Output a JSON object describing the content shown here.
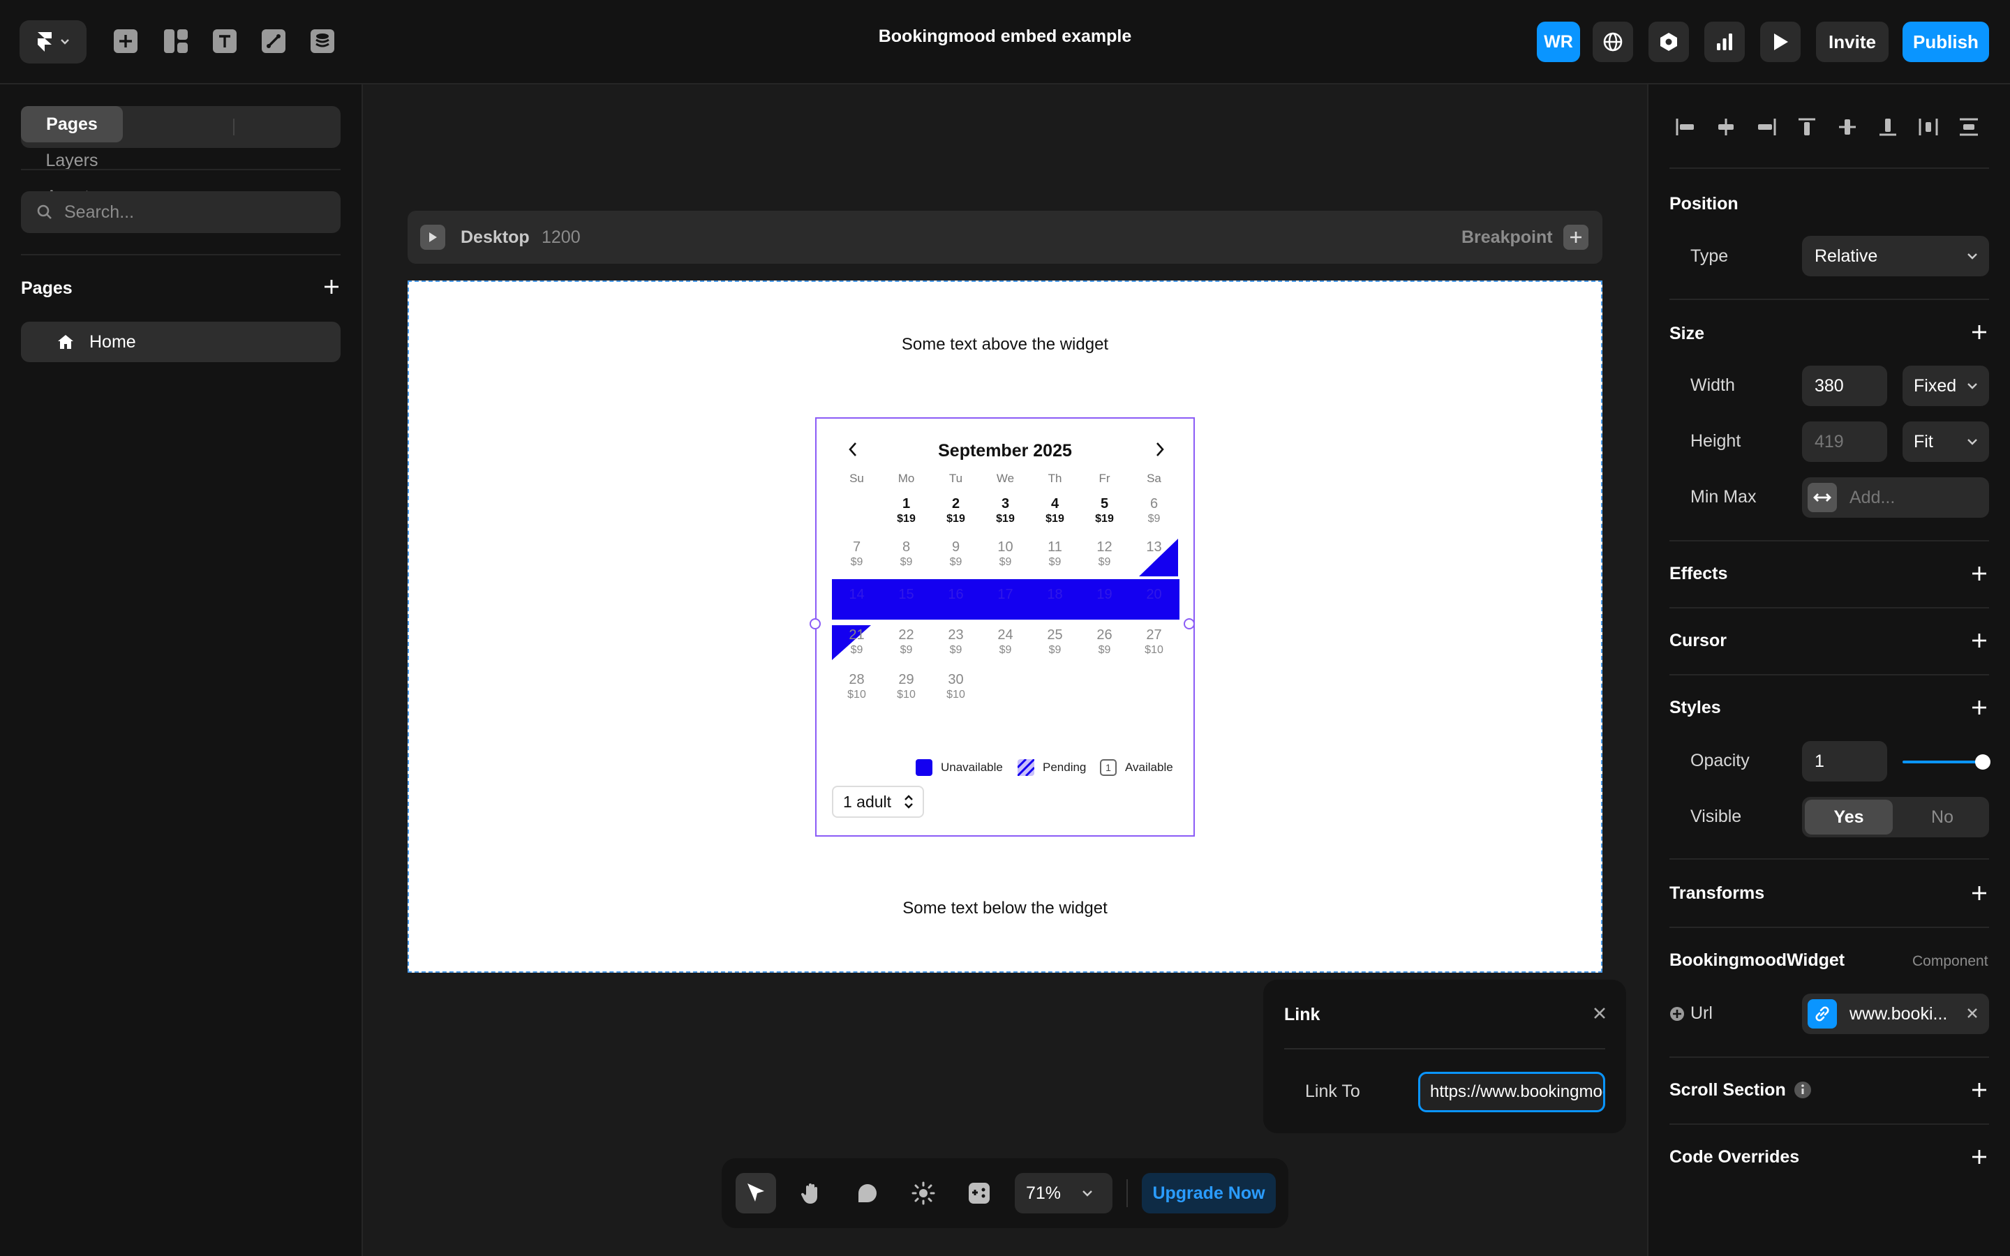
{
  "topbar": {
    "project_title": "Bookingmood embed example",
    "avatar_initials": "WR",
    "invite_label": "Invite",
    "publish_label": "Publish"
  },
  "left_panel": {
    "tabs": [
      "Pages",
      "Layers",
      "Assets"
    ],
    "active_tab": "Pages",
    "search_placeholder": "Search...",
    "pages_heading": "Pages",
    "pages": [
      {
        "label": "Home"
      }
    ]
  },
  "canvas": {
    "breakpoint": {
      "name": "Desktop",
      "width": "1200",
      "label": "Breakpoint"
    },
    "text_above": "Some text above the widget",
    "text_below": "Some text below the widget"
  },
  "widget": {
    "month_title": "September 2025",
    "weekdays": [
      "Su",
      "Mo",
      "Tu",
      "We",
      "Th",
      "Fr",
      "Sa"
    ],
    "legend": {
      "unavailable": "Unavailable",
      "pending": "Pending",
      "available": "Available",
      "available_icon_text": "1"
    },
    "guests": "1 adult",
    "colors": {
      "unavailable": "#1400f0",
      "pending": "#8c7cf0",
      "border": "#8b5cf6"
    },
    "rows": [
      [
        {
          "d": "",
          "p": "",
          "s": "empty"
        },
        {
          "d": "1",
          "p": "$19",
          "s": "available"
        },
        {
          "d": "2",
          "p": "$19",
          "s": "available"
        },
        {
          "d": "3",
          "p": "$19",
          "s": "available"
        },
        {
          "d": "4",
          "p": "$19",
          "s": "available"
        },
        {
          "d": "5",
          "p": "$19",
          "s": "available"
        },
        {
          "d": "6",
          "p": "$9",
          "s": "past"
        }
      ],
      [
        {
          "d": "7",
          "p": "$9",
          "s": "past"
        },
        {
          "d": "8",
          "p": "$9",
          "s": "past"
        },
        {
          "d": "9",
          "p": "$9",
          "s": "past"
        },
        {
          "d": "10",
          "p": "$9",
          "s": "past"
        },
        {
          "d": "11",
          "p": "$9",
          "s": "past"
        },
        {
          "d": "12",
          "p": "$9",
          "s": "past"
        },
        {
          "d": "13",
          "p": "",
          "s": "checkin"
        }
      ],
      [
        {
          "d": "14",
          "p": "",
          "s": "unavailable"
        },
        {
          "d": "15",
          "p": "",
          "s": "unavailable"
        },
        {
          "d": "16",
          "p": "",
          "s": "unavailable"
        },
        {
          "d": "17",
          "p": "",
          "s": "unavailable"
        },
        {
          "d": "18",
          "p": "",
          "s": "unavailable"
        },
        {
          "d": "19",
          "p": "",
          "s": "unavailable"
        },
        {
          "d": "20",
          "p": "",
          "s": "unavailable"
        }
      ],
      [
        {
          "d": "21",
          "p": "$9",
          "s": "checkout"
        },
        {
          "d": "22",
          "p": "$9",
          "s": "past"
        },
        {
          "d": "23",
          "p": "$9",
          "s": "past"
        },
        {
          "d": "24",
          "p": "$9",
          "s": "past"
        },
        {
          "d": "25",
          "p": "$9",
          "s": "past"
        },
        {
          "d": "26",
          "p": "$9",
          "s": "past"
        },
        {
          "d": "27",
          "p": "$10",
          "s": "past"
        }
      ],
      [
        {
          "d": "28",
          "p": "$10",
          "s": "past"
        },
        {
          "d": "29",
          "p": "$10",
          "s": "past"
        },
        {
          "d": "30",
          "p": "$10",
          "s": "past"
        },
        {
          "d": "",
          "p": "",
          "s": "empty"
        },
        {
          "d": "",
          "p": "",
          "s": "empty"
        },
        {
          "d": "",
          "p": "",
          "s": "empty"
        },
        {
          "d": "",
          "p": "",
          "s": "empty"
        }
      ]
    ]
  },
  "link_popover": {
    "title": "Link",
    "link_to_label": "Link To",
    "link_value": "https://www.bookingmood.com"
  },
  "bottom_toolbar": {
    "zoom": "71%",
    "upgrade_label": "Upgrade Now"
  },
  "right_panel": {
    "position": {
      "title": "Position",
      "type_label": "Type",
      "type_value": "Relative"
    },
    "size": {
      "title": "Size",
      "width_label": "Width",
      "width_value": "380",
      "width_mode": "Fixed",
      "height_label": "Height",
      "height_value": "419",
      "height_mode": "Fit",
      "minmax_label": "Min Max",
      "minmax_placeholder": "Add..."
    },
    "effects": {
      "title": "Effects"
    },
    "cursor": {
      "title": "Cursor"
    },
    "styles": {
      "title": "Styles",
      "opacity_label": "Opacity",
      "opacity_value": "1",
      "visible_label": "Visible",
      "visible_yes": "Yes",
      "visible_no": "No"
    },
    "transforms": {
      "title": "Transforms"
    },
    "component": {
      "title": "BookingmoodWidget",
      "kind": "Component",
      "url_label": "Url",
      "url_value": "www.booki..."
    },
    "scroll_section": {
      "title": "Scroll Section"
    },
    "code_overrides": {
      "title": "Code Overrides"
    }
  }
}
